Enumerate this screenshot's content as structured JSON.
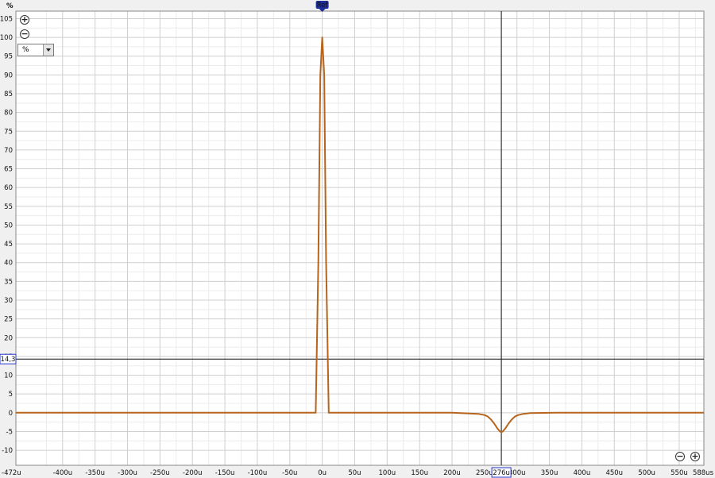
{
  "chart_data": {
    "type": "line",
    "ylabel": "%",
    "ylim": [
      -14,
      107
    ],
    "xlim": [
      -472,
      588
    ],
    "yticks": [
      105,
      100,
      95,
      90,
      85,
      80,
      75,
      70,
      65,
      60,
      55,
      50,
      45,
      40,
      35,
      30,
      25,
      20,
      15,
      10,
      5,
      0,
      -5,
      -10
    ],
    "xticks": [
      {
        "v": -472,
        "label": "-472u"
      },
      {
        "v": -400,
        "label": "-400u"
      },
      {
        "v": -350,
        "label": "-350u"
      },
      {
        "v": -300,
        "label": "-300u"
      },
      {
        "v": -250,
        "label": "-250u"
      },
      {
        "v": -200,
        "label": "-200u"
      },
      {
        "v": -150,
        "label": "-150u"
      },
      {
        "v": -100,
        "label": "-100u"
      },
      {
        "v": -50,
        "label": "-50u"
      },
      {
        "v": 0,
        "label": "0u"
      },
      {
        "v": 50,
        "label": "50u"
      },
      {
        "v": 100,
        "label": "100u"
      },
      {
        "v": 150,
        "label": "150u"
      },
      {
        "v": 200,
        "label": "200u"
      },
      {
        "v": 250,
        "label": "250u"
      },
      {
        "v": 300,
        "label": "300u"
      },
      {
        "v": 350,
        "label": "350u"
      },
      {
        "v": 400,
        "label": "400u"
      },
      {
        "v": 450,
        "label": "450u"
      },
      {
        "v": 500,
        "label": "500u"
      },
      {
        "v": 550,
        "label": "550u"
      },
      {
        "v": 588,
        "label": "588us"
      }
    ],
    "series": [
      {
        "color": "#b5651d",
        "x": [
          -472,
          -15,
          -10,
          -6,
          -3,
          0,
          3,
          6,
          10,
          15,
          100,
          200,
          240,
          250,
          255,
          260,
          265,
          270,
          274,
          276,
          278,
          282,
          287,
          292,
          297,
          302,
          310,
          320,
          360,
          450,
          588
        ],
        "y": [
          0,
          0,
          0,
          40,
          90,
          100,
          90,
          40,
          0,
          0,
          0,
          0,
          -0.3,
          -0.6,
          -1.0,
          -1.8,
          -2.9,
          -4.2,
          -5.0,
          -5.2,
          -5.0,
          -4.2,
          -2.9,
          -1.8,
          -1.0,
          -0.6,
          -0.3,
          -0.1,
          0,
          0,
          0
        ]
      }
    ],
    "crosshair": {
      "x": 276,
      "y": 14.3,
      "x_label": "276u",
      "y_label": "14,3"
    },
    "ref_marker": {
      "x": 0,
      "label": "Ref"
    }
  },
  "controls": {
    "unit_value": "%",
    "zoom_in_symbol": "+",
    "zoom_out_symbol": "−"
  }
}
